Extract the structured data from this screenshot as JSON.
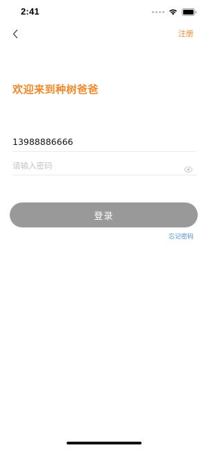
{
  "status_bar": {
    "time": "2:41",
    "icons": [
      "signal-icon",
      "wifi-icon",
      "battery-icon"
    ]
  },
  "nav": {
    "back_icon": "chevron-left-icon",
    "register_label": "注册"
  },
  "title": "欢迎来到种树爸爸",
  "form": {
    "phone_value": "13988886666",
    "password_value": "",
    "password_placeholder": "请输入密码",
    "visibility_icon": "eye-icon"
  },
  "login_button_label": "登录",
  "forgot_password_label": "忘记密码",
  "colors": {
    "accent": "#f0892a",
    "link": "#4a8fd8",
    "button_bg": "#999999",
    "button_text": "#ffffff"
  }
}
